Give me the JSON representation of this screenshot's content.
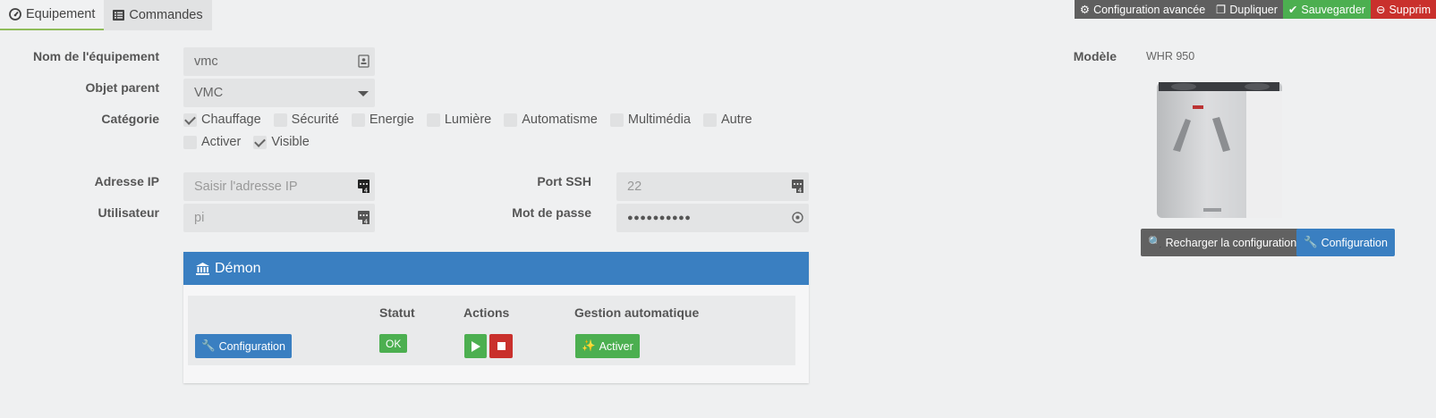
{
  "tabs": [
    {
      "label": "Equipement",
      "icon": "gauge-icon"
    },
    {
      "label": "Commandes",
      "icon": "list-icon"
    }
  ],
  "toolbar": {
    "advanced_config": "Configuration avancée",
    "duplicate": "Dupliquer",
    "save": "Sauvegarder",
    "delete": "Supprim"
  },
  "form": {
    "name_label": "Nom de l'équipement",
    "name_value": "vmc",
    "parent_label": "Objet parent",
    "parent_value": "VMC",
    "category_label": "Catégorie",
    "categories": [
      {
        "label": "Chauffage",
        "checked": true
      },
      {
        "label": "Sécurité",
        "checked": false
      },
      {
        "label": "Energie",
        "checked": false
      },
      {
        "label": "Lumière",
        "checked": false
      },
      {
        "label": "Automatisme",
        "checked": false
      },
      {
        "label": "Multimédia",
        "checked": false
      },
      {
        "label": "Autre",
        "checked": false
      }
    ],
    "flags": [
      {
        "label": "Activer",
        "checked": false
      },
      {
        "label": "Visible",
        "checked": true
      }
    ],
    "ip_label": "Adresse IP",
    "ip_placeholder": "Saisir l'adresse IP",
    "port_label": "Port SSH",
    "port_value": "22",
    "user_label": "Utilisateur",
    "user_value": "pi",
    "password_label": "Mot de passe",
    "password_value": "●●●●●●●●●●"
  },
  "daemon": {
    "title": "Démon",
    "headers": {
      "status": "Statut",
      "actions": "Actions",
      "auto": "Gestion automatique"
    },
    "config_button": "Configuration",
    "status_value": "OK",
    "auto_button": "Activer"
  },
  "model": {
    "label": "Modèle",
    "value": "WHR 950",
    "reload_button": "Recharger la configuration",
    "config_button": "Configuration"
  },
  "colors": {
    "primary": "#3a7fc1",
    "success": "#4caf50",
    "danger": "#c9302c",
    "dark": "#5f5f5f"
  }
}
